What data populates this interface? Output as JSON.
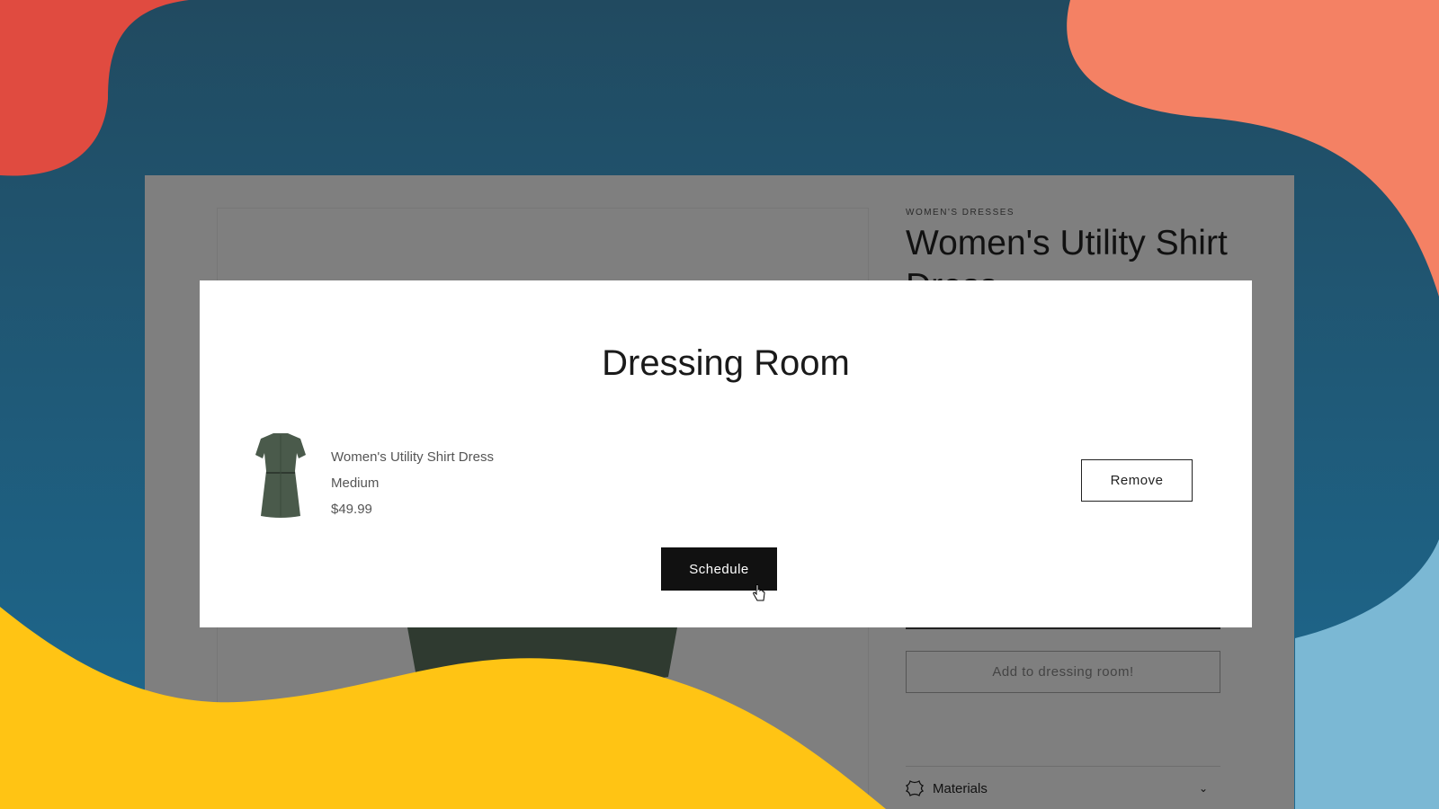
{
  "colors": {
    "bg_dark": "#214a60",
    "bg_blue": "#1f6a8f",
    "red": "#e04b40",
    "salmon": "#f48164",
    "yellow": "#ffc414",
    "light_blue": "#7bb8d4"
  },
  "product_page": {
    "category": "WOMEN'S DRESSES",
    "title": "Women's Utility Shirt Dress",
    "add_button": "Add to dressing room!",
    "materials_label": "Materials"
  },
  "modal": {
    "title": "Dressing Room",
    "item": {
      "name": "Women's Utility Shirt Dress",
      "size": "Medium",
      "price": "$49.99"
    },
    "remove_label": "Remove",
    "schedule_label": "Schedule"
  }
}
